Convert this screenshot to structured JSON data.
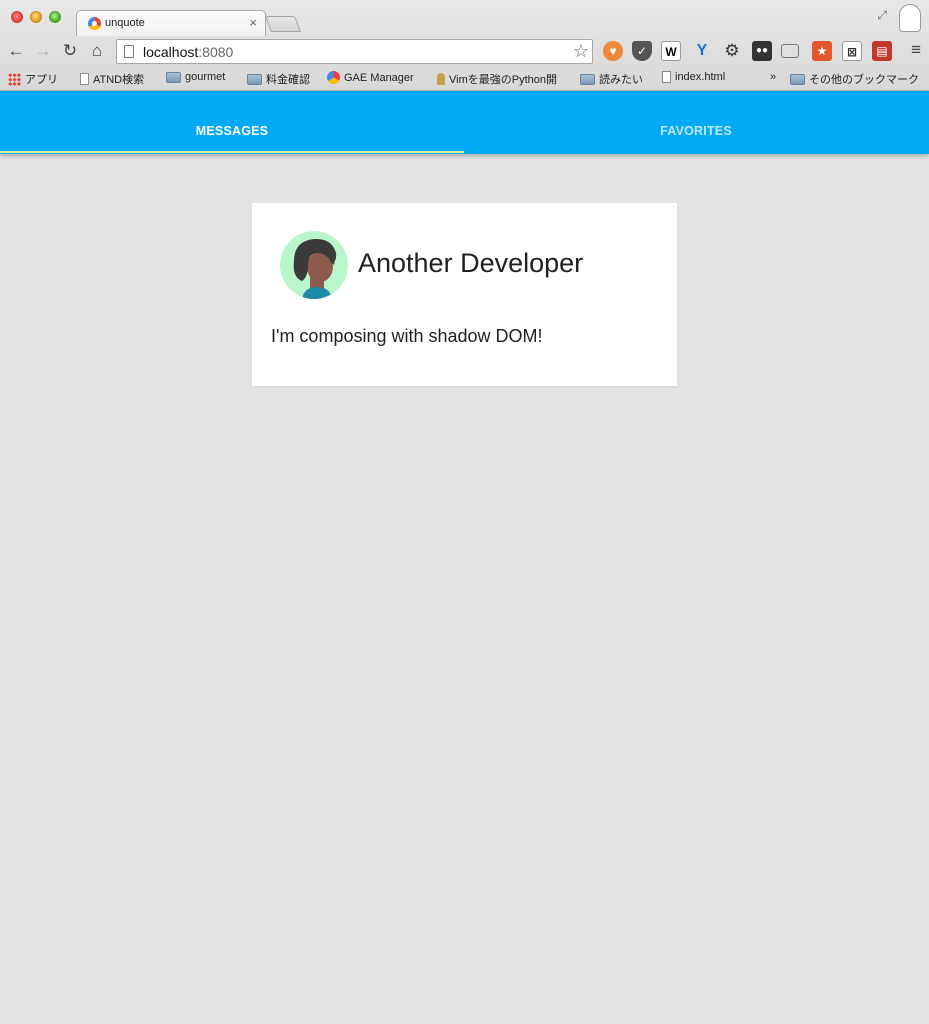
{
  "browser": {
    "tab_title": "unquote",
    "tab_close": "×",
    "url_host": "localhost",
    "url_port": ":8080",
    "bookmarks": [
      {
        "label": "アプリ",
        "icon": "apps-icon"
      },
      {
        "label": "ATND検索",
        "icon": "page-icon"
      },
      {
        "label": "gourmet",
        "icon": "folder-icon"
      },
      {
        "label": "料金確認",
        "icon": "folder-icon"
      },
      {
        "label": "GAE Manager",
        "icon": "gae-icon"
      },
      {
        "label": "Vimを最強のPython開",
        "icon": "python-icon"
      },
      {
        "label": "読みたい",
        "icon": "folder-icon"
      },
      {
        "label": "index.html",
        "icon": "page-icon"
      },
      {
        "label": "その他のブックマーク",
        "icon": "folder-icon"
      }
    ],
    "bookmarks_overflow": "»",
    "extension_w_label": "W"
  },
  "app": {
    "tabs": [
      {
        "label": "MESSAGES",
        "active": true
      },
      {
        "label": "FAVORITES",
        "active": false
      }
    ],
    "card": {
      "author": "Another Developer",
      "message": "I'm composing with shadow DOM!"
    },
    "colors": {
      "app_bar": "#03a9f4",
      "background": "#e3e3e3",
      "avatar_bg": "#b9f6ca"
    }
  }
}
